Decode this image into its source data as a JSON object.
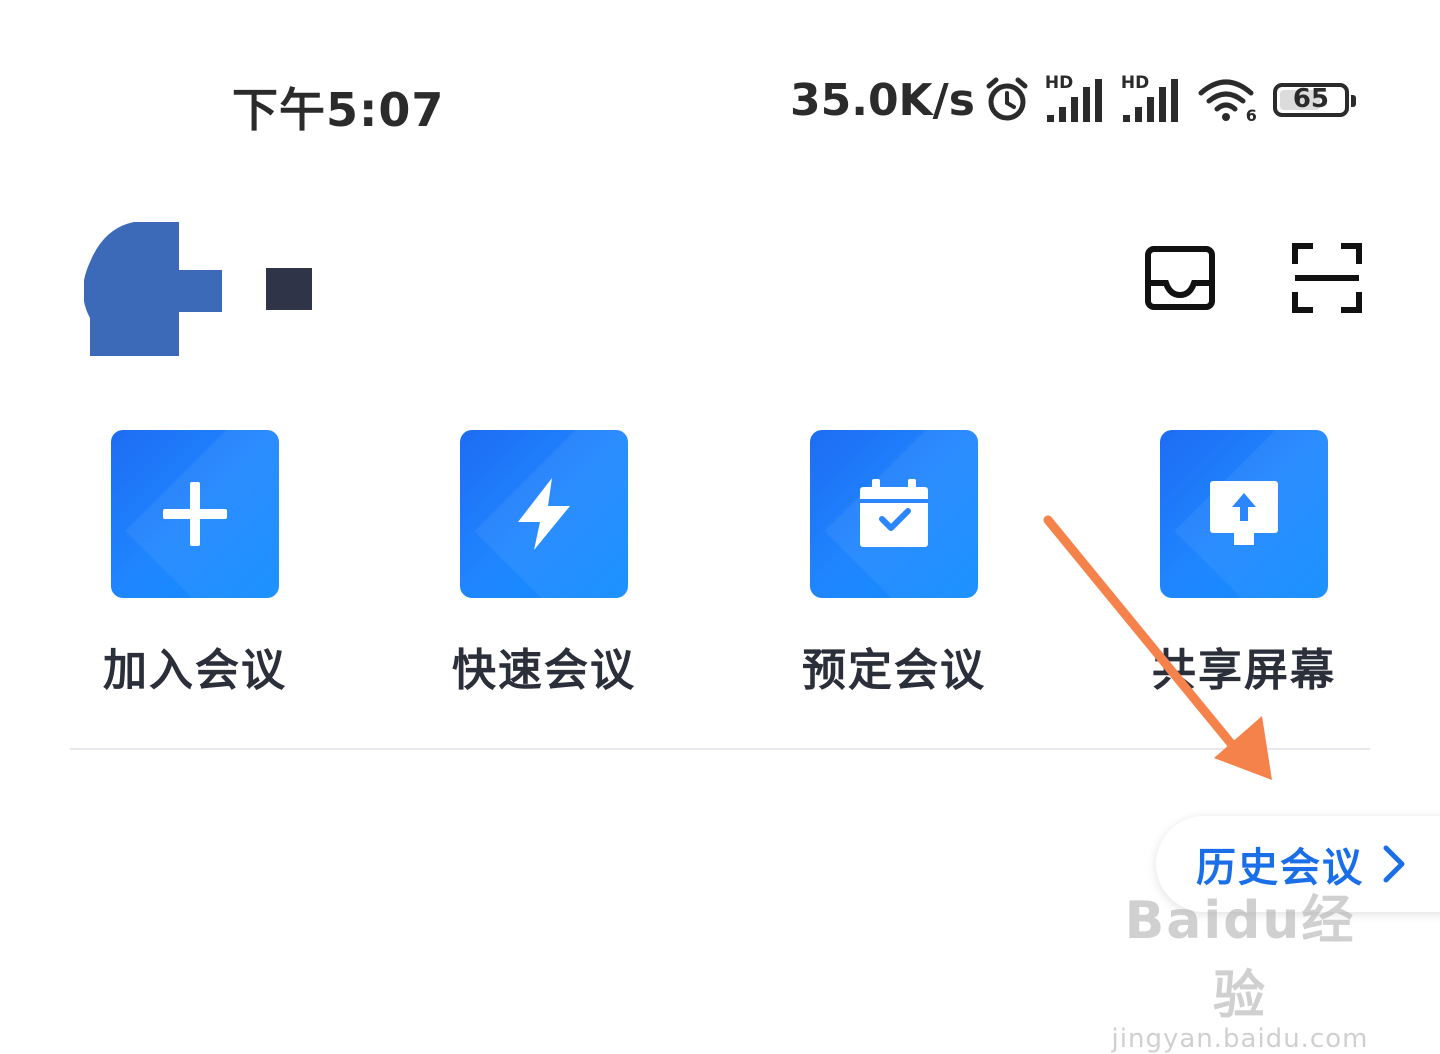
{
  "status_bar": {
    "time": "下午5:07",
    "net_speed": "35.0K/s",
    "signal1_tag": "HD",
    "signal2_tag": "HD",
    "wifi_tag": "6",
    "battery_percent": 65,
    "battery_text": "65",
    "icons": [
      "alarm-icon",
      "signal-icon",
      "signal-icon",
      "wifi-icon",
      "battery-icon"
    ]
  },
  "header": {
    "icons": [
      "inbox-icon",
      "scan-icon"
    ]
  },
  "actions": [
    {
      "label": "加入会议",
      "icon": "plus-icon"
    },
    {
      "label": "快速会议",
      "icon": "lightning-icon"
    },
    {
      "label": "预定会议",
      "icon": "calendar-check-icon"
    },
    {
      "label": "共享屏幕",
      "icon": "screen-share-icon"
    }
  ],
  "history": {
    "label": "历史会议",
    "icon": "chevron-right-icon"
  },
  "watermark": {
    "main": "Baidu经验",
    "sub": "jingyan.baidu.com"
  },
  "colors": {
    "tile_blue": "#1f80ff",
    "accent_blue": "#1a6fe8",
    "arrow_orange": "#f5824a",
    "text_dark": "#2b2f3a",
    "logo_blue": "#3c6ab8"
  }
}
